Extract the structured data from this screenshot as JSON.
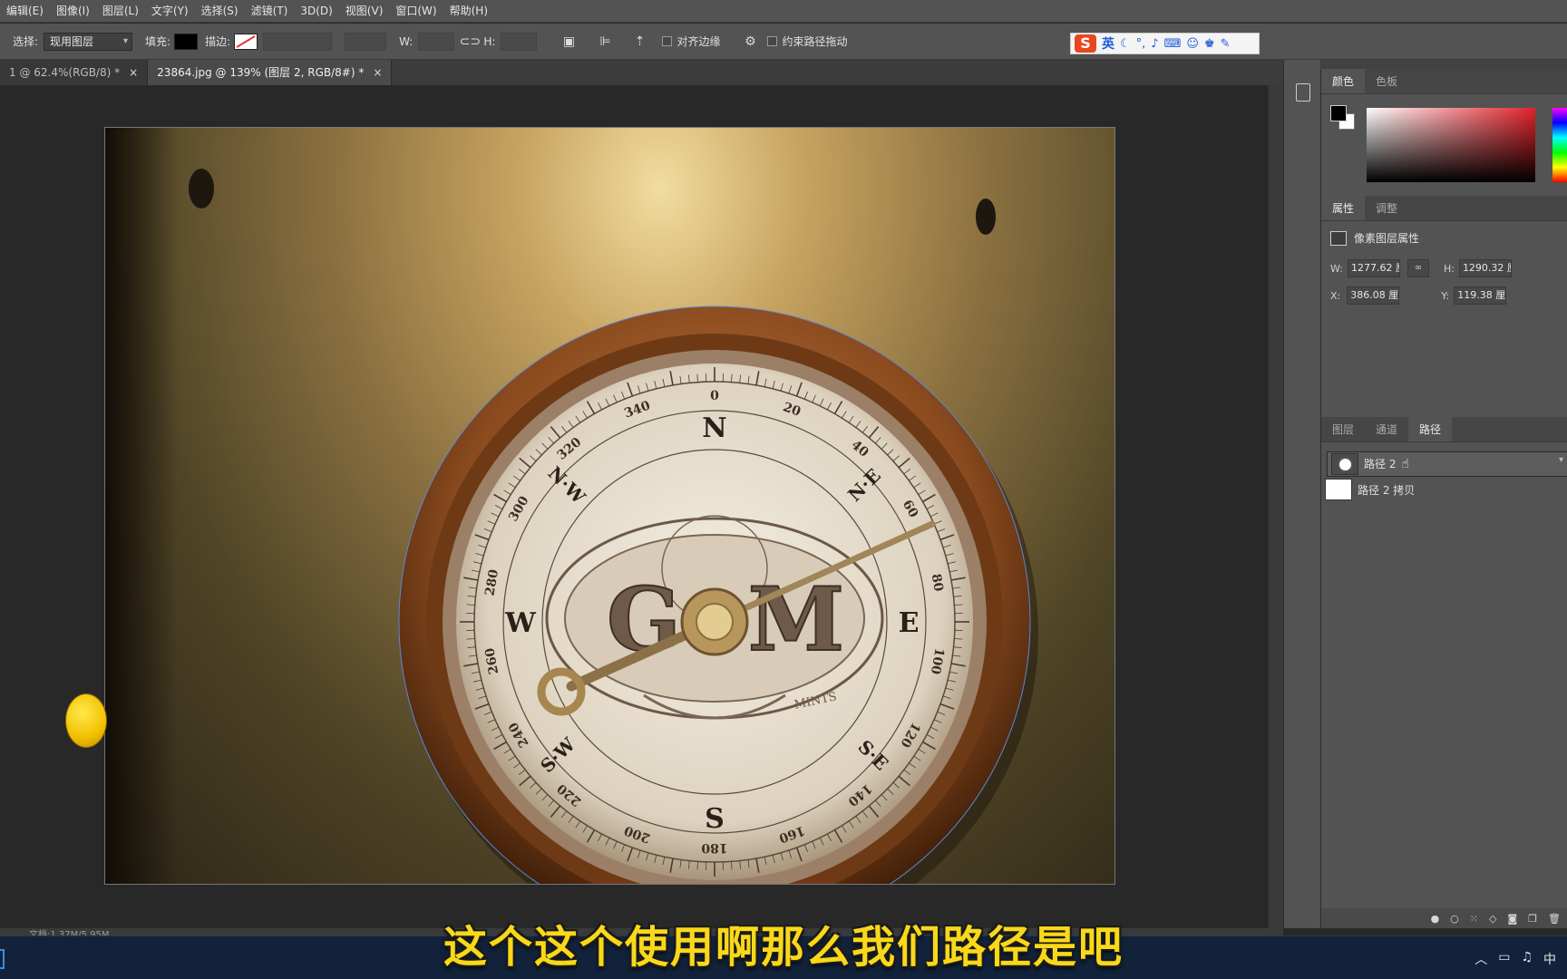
{
  "menu": [
    "编辑(E)",
    "图像(I)",
    "图层(L)",
    "文字(Y)",
    "选择(S)",
    "滤镜(T)",
    "3D(D)",
    "视图(V)",
    "窗口(W)",
    "帮助(H)"
  ],
  "options": {
    "select_label": "选择:",
    "select_value": "现用图层",
    "fill_label": "填充:",
    "stroke_label": "描边:",
    "w_label": "W:",
    "h_label": "H:",
    "align_edges": "对齐边缘",
    "constrain_path": "约束路径拖动",
    "fill_color": "#000000"
  },
  "ime": {
    "logo": "S",
    "mode": "英"
  },
  "tabs": [
    {
      "label": "1 @ 62.4%(RGB/8) *"
    },
    {
      "label": "23864.jpg @ 139% (图层 2, RGB/8#) *"
    }
  ],
  "compass": {
    "cardinals": [
      "N",
      "E",
      "S",
      "W"
    ],
    "intercardinals": [
      "N·E",
      "S·E",
      "S·W",
      "N·W"
    ],
    "degrees": [
      "0",
      "20",
      "40",
      "60",
      "80",
      "100",
      "120",
      "140",
      "160",
      "180",
      "200",
      "220",
      "240",
      "260",
      "280",
      "300",
      "320",
      "340"
    ],
    "monogram_left": "G",
    "monogram_right": "M",
    "ribbon_right": "MINTS"
  },
  "status": {
    "doc": "文档:1.37M/5.95M"
  },
  "color_panel": {
    "tabs": [
      "颜色",
      "色板"
    ],
    "fg": "#000000",
    "bg": "#ffffff"
  },
  "properties_panel": {
    "tabs": [
      "属性",
      "调整"
    ],
    "title": "像素图层属性",
    "w_label": "W:",
    "w": "1277.62 厘",
    "h_label": "H:",
    "h": "1290.32 厘",
    "x_label": "X:",
    "x": "386.08 厘:",
    "y_label": "Y:",
    "y": "119.38 厘:"
  },
  "paths_panel": {
    "tabs": [
      "图层",
      "通道",
      "路径"
    ],
    "items": [
      "路径 2",
      "路径 2 拷贝"
    ]
  },
  "subtitle": "这个这个使用啊那么我们路径是吧",
  "tray": {
    "lang": "中"
  }
}
